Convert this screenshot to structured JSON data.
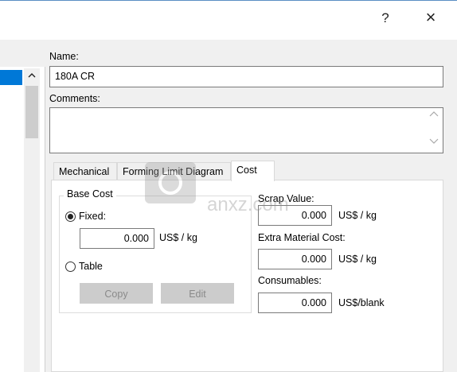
{
  "titlebar": {
    "help_glyph": "?",
    "close_glyph": "×"
  },
  "name": {
    "label": "Name:",
    "value": "180A CR"
  },
  "comments": {
    "label": "Comments:",
    "value": ""
  },
  "tabs": [
    {
      "label": "Mechanical",
      "active": false
    },
    {
      "label": "Forming Limit Diagram",
      "active": false
    },
    {
      "label": "Cost",
      "active": true
    }
  ],
  "base_cost": {
    "title": "Base Cost",
    "fixed_label": "Fixed:",
    "fixed_selected": true,
    "fixed_value": "0.000",
    "fixed_unit": "US$ / kg",
    "table_label": "Table",
    "copy_button": "Copy",
    "edit_button": "Edit"
  },
  "scrap_value": {
    "label": "Scrap Value:",
    "value": "0.000",
    "unit": "US$ / kg"
  },
  "extra_material_cost": {
    "label": "Extra Material Cost:",
    "value": "0.000",
    "unit": "US$ / kg"
  },
  "consumables": {
    "label": "Consumables:",
    "value": "0.000",
    "unit": "US$/blank"
  },
  "watermark": {
    "text": "anxz.com"
  },
  "colors": {
    "selection": "#0078d7",
    "border": "#7a7a7a",
    "disabled_button": "#cccccc"
  }
}
